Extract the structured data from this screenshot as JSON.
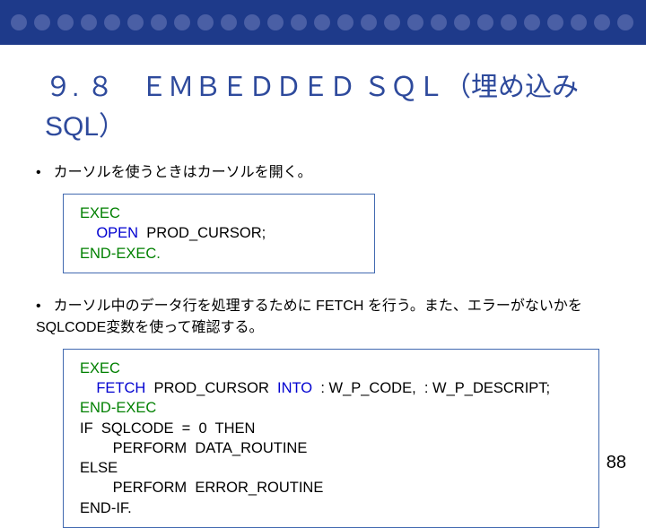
{
  "title": "９. ８　ＥＭＢＥＤＤＥＤ ＳＱＬ（埋め込みSQL）",
  "bullet1": "カーソルを使うときはカーソルを開く。",
  "bullet2": "カーソル中のデータ行を処理するために FETCH を行う。また、エラーがないかをSQLCODE変数を使って確認する。",
  "code1": {
    "l1a": "EXEC",
    "l2a": "    OPEN",
    "l2b": "  PROD_CURSOR;",
    "l3a": "END-EXEC."
  },
  "code2": {
    "l1a": "EXEC",
    "l2a": "    FETCH",
    "l2b": "  PROD_CURSOR  ",
    "l2c": "INTO",
    "l2d": "  : W_P_CODE,  : W_P_DESCRIPT;",
    "l3a": "END-EXEC",
    "l4a": "IF  SQLCODE  =  0  THEN",
    "l5a": "        PERFORM  DATA_ROUTINE",
    "l6a": "ELSE",
    "l7a": "        PERFORM  ERROR_ROUTINE",
    "l8a": "END-IF."
  },
  "page_number": "88"
}
